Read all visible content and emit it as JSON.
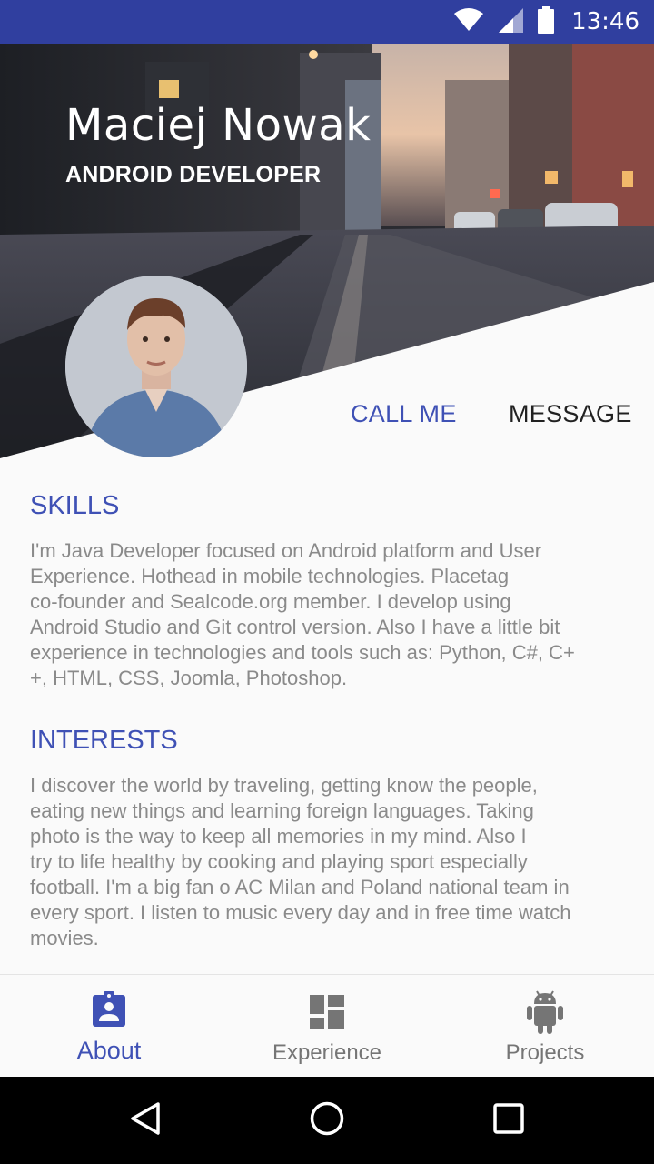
{
  "status_bar": {
    "time": "13:46",
    "icons": [
      "wifi-icon",
      "signal-icon",
      "battery-icon"
    ],
    "color": "#303f9f"
  },
  "profile": {
    "name": "Maciej Nowak",
    "role": "ANDROID DEVELOPER"
  },
  "actions": {
    "call_label": "CALL ME",
    "message_label": "MESSAGE"
  },
  "sections": {
    "skills": {
      "title": "SKILLS",
      "lines": [
        "I'm Java Developer focused on Android platform and User",
        "Experience. Hothead in mobile technologies. Placetag",
        "co-founder and Sealcode.org member. I develop using",
        "Android Studio and Git control version. Also I have a little bit",
        "experience in technologies and tools such as: Python, C#, C+",
        "+, HTML, CSS, Joomla, Photoshop."
      ]
    },
    "interests": {
      "title": "INTERESTS",
      "lines": [
        "I discover the world by traveling, getting know the people,",
        "eating new things and learning foreign languages. Taking",
        "photo is the way to keep all memories in my mind. Also I",
        "try to life healthy by cooking and playing sport especially",
        "football. I'm a big fan o AC Milan and Poland national team in",
        "every sport. I listen to music every day and in free time watch",
        "movies."
      ]
    }
  },
  "bottom_nav": {
    "items": [
      {
        "label": "About",
        "icon": "about-badge-icon",
        "active": true
      },
      {
        "label": "Experience",
        "icon": "dashboard-icon",
        "active": false
      },
      {
        "label": "Projects",
        "icon": "android-icon",
        "active": false
      }
    ]
  },
  "system_nav": {
    "icons": [
      "back-icon",
      "home-icon",
      "recents-icon"
    ]
  },
  "colors": {
    "accent": "#3f51b5",
    "status_bar": "#303f9f",
    "body_text": "#8a8a8a",
    "dark_text": "#212121"
  }
}
